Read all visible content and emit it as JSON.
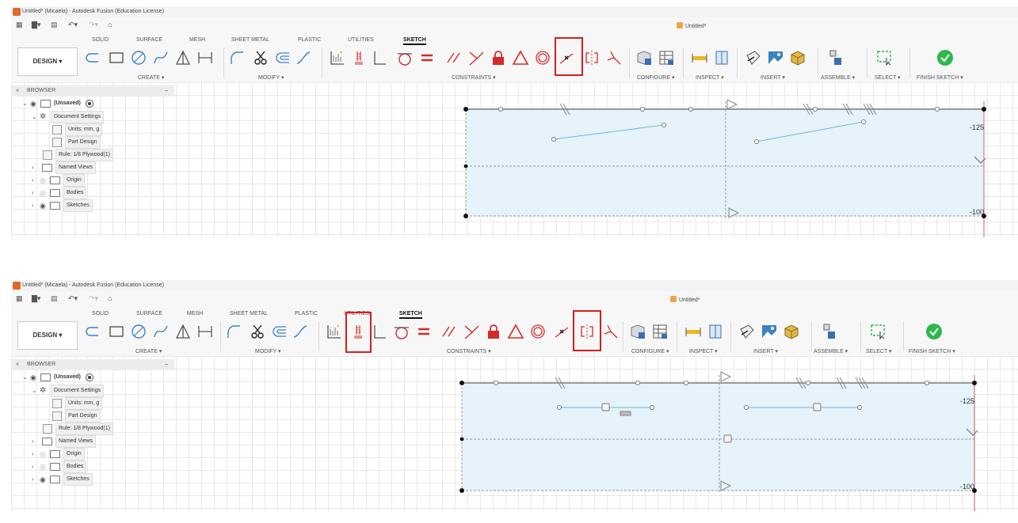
{
  "window_title": "Untitled* (Micaela) - Autodesk Fusion (Education License)",
  "document_tab": "Untitled*",
  "workspace_button": "DESIGN ▾",
  "ribbon_tabs": [
    "SOLID",
    "SURFACE",
    "MESH",
    "SHEET METAL",
    "PLASTIC",
    "UTILITIES",
    "SKETCH"
  ],
  "active_tab": "SKETCH",
  "groups": {
    "create": "CREATE ▾",
    "modify": "MODIFY ▾",
    "constraints": "CONSTRAINTS ▾",
    "configure": "CONFIGURE ▾",
    "inspect": "INSPECT ▾",
    "insert": "INSERT ▾",
    "assemble": "ASSEMBLE ▾",
    "select": "SELECT ▾",
    "finish_sketch": "FINISH SKETCH ▾"
  },
  "browser": {
    "title": "BROWSER",
    "collapse": "«",
    "minimize": "–",
    "root": "(Unsaved)",
    "items": [
      "Document Settings",
      "Units: mm, g",
      "Part Design",
      "Rule: 1/8 Plywood(1)",
      "Named Views",
      "Origin",
      "Bodies",
      "Sketches"
    ]
  },
  "dimensions": {
    "top": "-125",
    "bottom": "-100"
  },
  "highlight_color": "#d61e1e",
  "colors": {
    "sketch_fill": "#e6f3fa",
    "sketch_line": "#6fb6dc",
    "finish_green": "#2db84b",
    "constraint_red": "#d42a2a"
  },
  "panels": [
    {
      "id": "before",
      "highlighted_tools": [
        "midpoint-constraint"
      ]
    },
    {
      "id": "after",
      "highlighted_tools": [
        "show-hide-constraints",
        "symmetry-constraint"
      ]
    }
  ]
}
